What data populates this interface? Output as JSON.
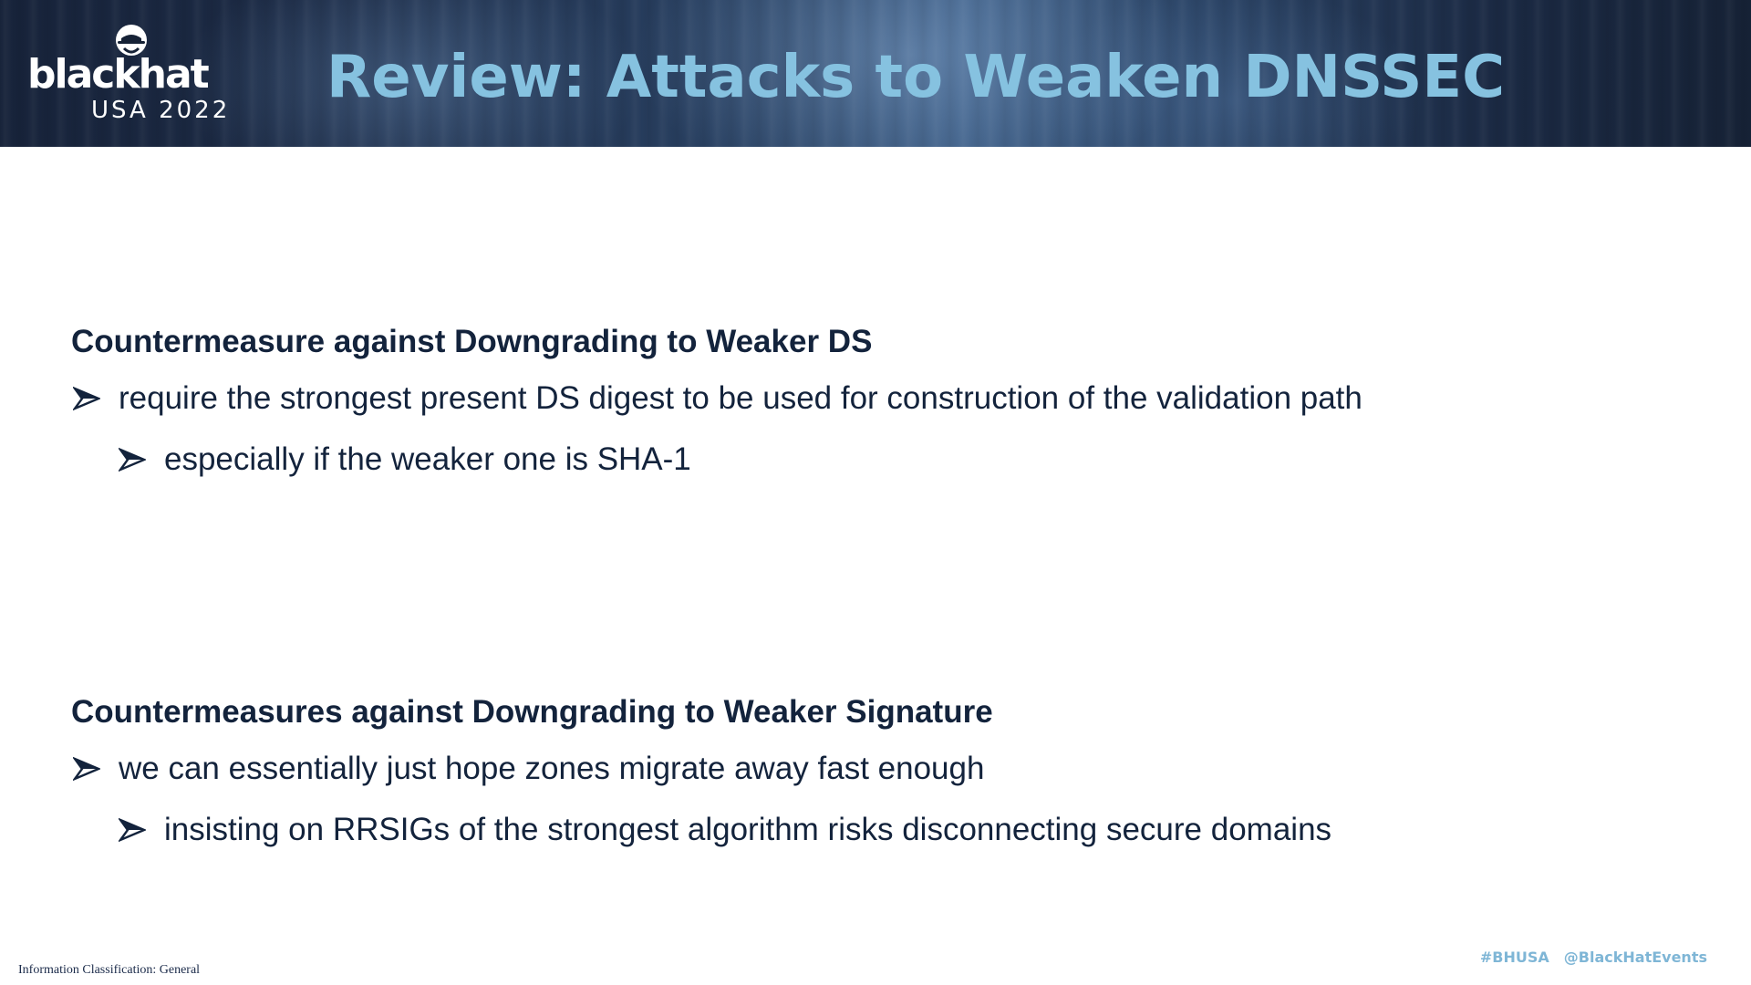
{
  "header": {
    "logo": {
      "wordmark": "blackhat",
      "event": "USA 2022"
    },
    "title": "Review: Attacks to Weaken DNSSEC"
  },
  "sections": [
    {
      "heading": "Countermeasure against Downgrading to Weaker DS",
      "bullets": [
        {
          "level": 1,
          "text": "require the strongest present DS digest to be used for construction of the validation path"
        },
        {
          "level": 2,
          "text": "especially if the weaker one is SHA-1"
        }
      ]
    },
    {
      "heading": "Countermeasures against Downgrading to Weaker Signature",
      "bullets": [
        {
          "level": 1,
          "text": "we can essentially just hope zones migrate away fast enough"
        },
        {
          "level": 2,
          "text": "insisting on RRSIGs of the strongest algorithm risks disconnecting secure domains"
        }
      ]
    }
  ],
  "footer": {
    "classification": "Information Classification: General",
    "hashtag": "#BHUSA",
    "handle": "@BlackHatEvents"
  },
  "colors": {
    "title": "#86c2e0",
    "body_text": "#13233c",
    "header_bg": "#162236",
    "footer_social": "#7fb6d6"
  },
  "icons": {
    "bullet": "arrowhead-bullet-icon",
    "logo": "spy-hat-logo-icon"
  }
}
